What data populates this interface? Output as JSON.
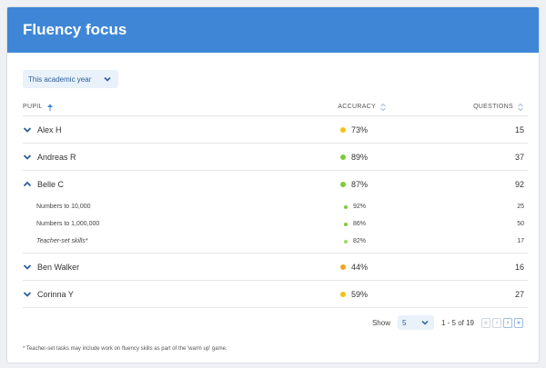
{
  "title": "Fluency focus",
  "filter": {
    "selected": "This academic year"
  },
  "columns": {
    "pupil": "PUPIL",
    "accuracy": "ACCURACY",
    "questions": "QUESTIONS"
  },
  "rows": [
    {
      "name": "Alex H",
      "accuracy": "73%",
      "questions": "15",
      "dot_color": "#f3c116",
      "expanded": false
    },
    {
      "name": "Andreas R",
      "accuracy": "89%",
      "questions": "37",
      "dot_color": "#7ccb3b",
      "expanded": false
    },
    {
      "name": "Belle C",
      "accuracy": "87%",
      "questions": "92",
      "dot_color": "#7ccb3b",
      "expanded": true,
      "children": [
        {
          "name": "Numbers to 10,000",
          "accuracy": "92%",
          "questions": "25",
          "dot_color": "#7ccb3b"
        },
        {
          "name": "Numbers to 1,000,000",
          "accuracy": "86%",
          "questions": "50",
          "dot_color": "#7ccb3b"
        },
        {
          "name": "Teacher-set skills*",
          "accuracy": "82%",
          "questions": "17",
          "dot_color": "#a5d85d"
        }
      ]
    },
    {
      "name": "Ben Walker",
      "accuracy": "44%",
      "questions": "16",
      "dot_color": "#f2a51f",
      "expanded": false
    },
    {
      "name": "Corinna Y",
      "accuracy": "59%",
      "questions": "27",
      "dot_color": "#f3c116",
      "expanded": false
    }
  ],
  "pagination": {
    "show_label": "Show",
    "page_size": "5",
    "range": "1 - 5 of 19"
  },
  "footnote": "* Teacher-set tasks may include work on fluency skills as part of the 'warm up' game."
}
